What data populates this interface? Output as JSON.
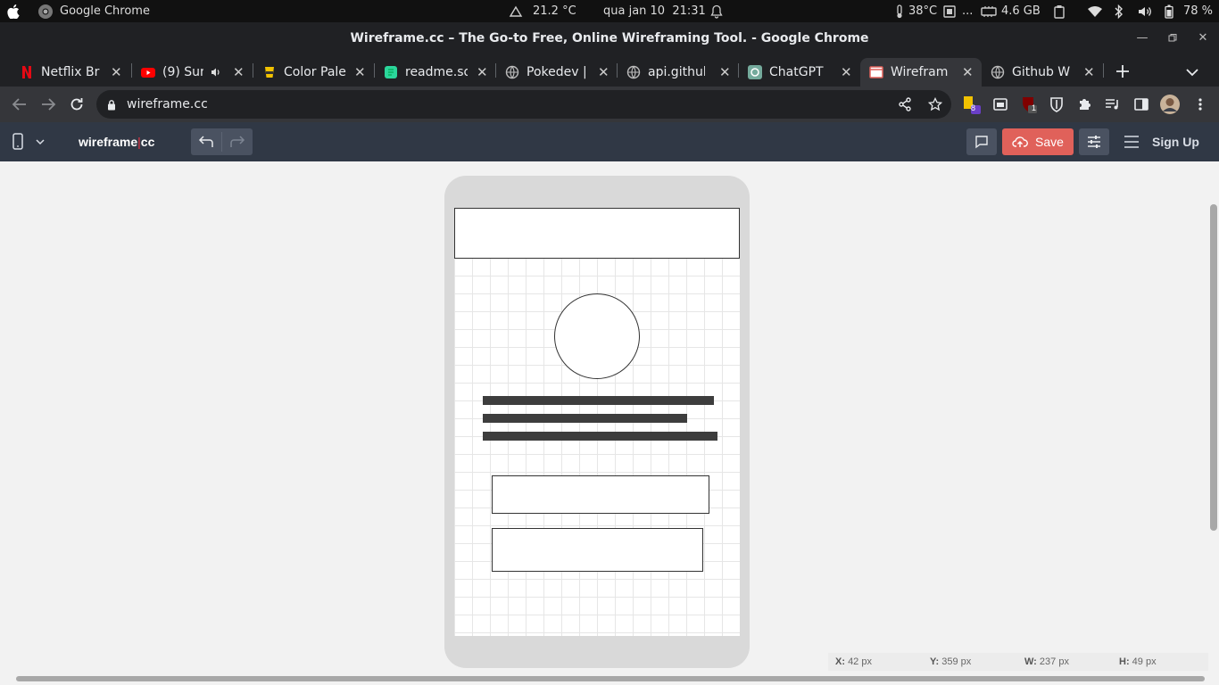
{
  "os": {
    "app_name": "Google Chrome",
    "weather": "21.2 °C",
    "datetime": "qua jan 10  21:31",
    "temp": "38°C",
    "mem_dots": "...",
    "mem": "4.6 GB",
    "battery": "78 %"
  },
  "window": {
    "title": "Wireframe.cc – The Go-to Free, Online Wireframing Tool. - Google Chrome"
  },
  "tabs": [
    {
      "label": "Netflix Br",
      "favicon": "netflix-icon",
      "color": "#e50914"
    },
    {
      "label": "(9) Sun",
      "favicon": "youtube-icon",
      "color": "#ff0000",
      "audio": true
    },
    {
      "label": "Color Pale",
      "favicon": "color-palette-icon",
      "color": "#f2c200"
    },
    {
      "label": "readme.so",
      "favicon": "readme-icon",
      "color": "#2bd69b"
    },
    {
      "label": "Pokedev |",
      "favicon": "globe-icon",
      "color": "#bbbbbb"
    },
    {
      "label": "api.github",
      "favicon": "globe-icon",
      "color": "#bbbbbb"
    },
    {
      "label": "ChatGPT",
      "favicon": "chatgpt-icon",
      "color": "#74aa9c"
    },
    {
      "label": "Wirefram",
      "favicon": "wireframe-icon",
      "color": "#e0615a",
      "active": true
    },
    {
      "label": "Github W",
      "favicon": "globe-icon",
      "color": "#bbbbbb"
    }
  ],
  "omnibox": {
    "url": "wireframe.cc"
  },
  "extensions": {
    "badge1": "8",
    "badge2": "1"
  },
  "app": {
    "brand_left": "wireframe",
    "brand_sep": "|",
    "brand_right": "cc",
    "save_label": "Save",
    "signup_label": "Sign Up",
    "accent": "#e0615a",
    "header_bg": "#303845"
  },
  "readout": {
    "x_label": "X:",
    "x_value": "42 px",
    "y_label": "Y:",
    "y_value": "359 px",
    "w_label": "W:",
    "w_value": "237 px",
    "h_label": "H:",
    "h_value": "49 px"
  }
}
